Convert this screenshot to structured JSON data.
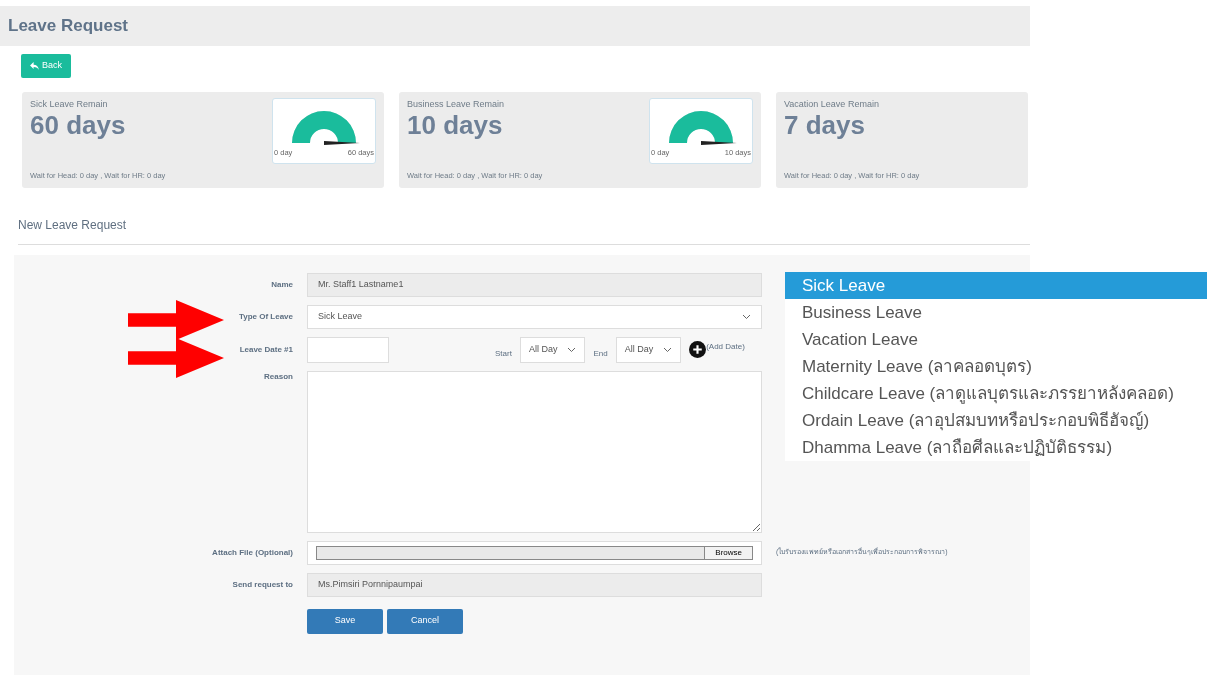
{
  "page": {
    "title": "Leave Request",
    "back_button": "Back"
  },
  "summary_cards": [
    {
      "title": "Sick Leave Remain",
      "value": "60 days",
      "note": "Wait for Head: 0 day , Wait for HR: 0 day",
      "gauge": {
        "min_label": "0 day",
        "max_label": "60 days"
      }
    },
    {
      "title": "Business Leave Remain",
      "value": "10 days",
      "note": "Wait for Head: 0 day , Wait for HR: 0 day",
      "gauge": {
        "min_label": "0 day",
        "max_label": "10 days"
      }
    },
    {
      "title": "Vacation Leave Remain",
      "value": "7 days",
      "note": "Wait for Head: 0 day , Wait for HR: 0 day"
    }
  ],
  "form": {
    "title": "New Leave Request",
    "name": {
      "label": "Name",
      "value": "Mr. Staff1  Lastname1"
    },
    "type_of_leave": {
      "label": "Type Of Leave",
      "value": "Sick Leave"
    },
    "leave_date": {
      "label": "Leave Date #1",
      "start_label": "Start",
      "start_value": "All Day",
      "end_label": "End",
      "end_value": "All Day",
      "add_label": "(Add Date)"
    },
    "reason": {
      "label": "Reason"
    },
    "attach": {
      "label": "Attach File (Optional)",
      "browse": "Browse",
      "note": "(ใบรับรองแพทย์หรือเอกสารอื่นๆเพื่อประกอบการพิจารณา)"
    },
    "send_to": {
      "label": "Send request to",
      "value": "Ms.Pimsiri  Pornnipaumpai"
    },
    "buttons": [
      "Save",
      "Cancel"
    ]
  },
  "leave_type_dropdown": [
    {
      "label": "Sick Leave",
      "selected": true
    },
    {
      "label": "Business Leave",
      "selected": false
    },
    {
      "label": "Vacation Leave",
      "selected": false
    },
    {
      "label": "Maternity Leave (ลาคลอดบุตร)",
      "selected": false
    },
    {
      "label": "Childcare Leave (ลาดูแลบุตรและภรรยาหลังคลอด)",
      "selected": false
    },
    {
      "label": "Ordain Leave (ลาอุปสมบทหรือประกอบพิธีฮัจญ์)",
      "selected": false
    },
    {
      "label": "Dhamma Leave (ลาถือศีลและปฏิบัติธรรม)",
      "selected": false
    }
  ],
  "annotation_arrows": [
    {
      "kind": "arrow"
    },
    {
      "kind": "arrow"
    }
  ]
}
